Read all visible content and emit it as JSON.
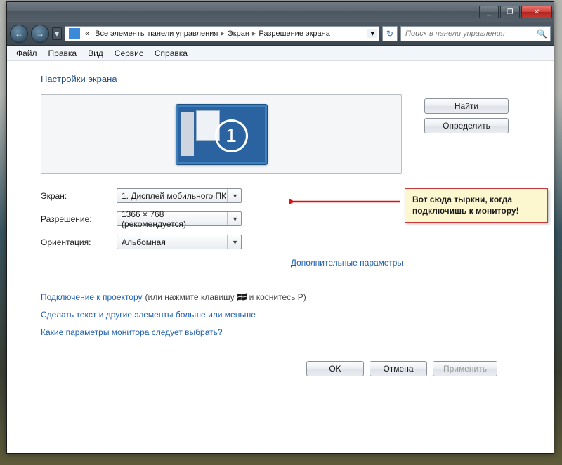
{
  "window_controls": {
    "min": "_",
    "max": "❐",
    "close": "✕"
  },
  "nav": {
    "back": "←",
    "fwd": "→",
    "crumb_prefix": "«",
    "crumbs": [
      "Все элементы панели управления",
      "Экран",
      "Разрешение экрана"
    ],
    "refresh": "↻",
    "search_placeholder": "Поиск в панели управления"
  },
  "menu": [
    "Файл",
    "Правка",
    "Вид",
    "Сервис",
    "Справка"
  ],
  "page_title": "Настройки экрана",
  "display": {
    "number": "1"
  },
  "buttons": {
    "find": "Найти",
    "detect": "Определить",
    "ok": "OK",
    "cancel": "Отмена",
    "apply": "Применить"
  },
  "fields": {
    "screen_label": "Экран:",
    "screen_value": "1. Дисплей мобильного ПК",
    "res_label": "Разрешение:",
    "res_value": "1366 × 768 (рекомендуется)",
    "orient_label": "Ориентация:",
    "orient_value": "Альбомная"
  },
  "adv_link": "Дополнительные параметры",
  "links": {
    "projector": "Подключение к проектору",
    "projector_suffix_a": "(или нажмите клавишу",
    "projector_suffix_b": "и коснитесь P)",
    "textsize": "Сделать текст и другие элементы больше или меньше",
    "which": "Какие параметры монитора следует выбрать?"
  },
  "callout": "Вот сюда тыркни, когда\nподключишь к монитору!"
}
